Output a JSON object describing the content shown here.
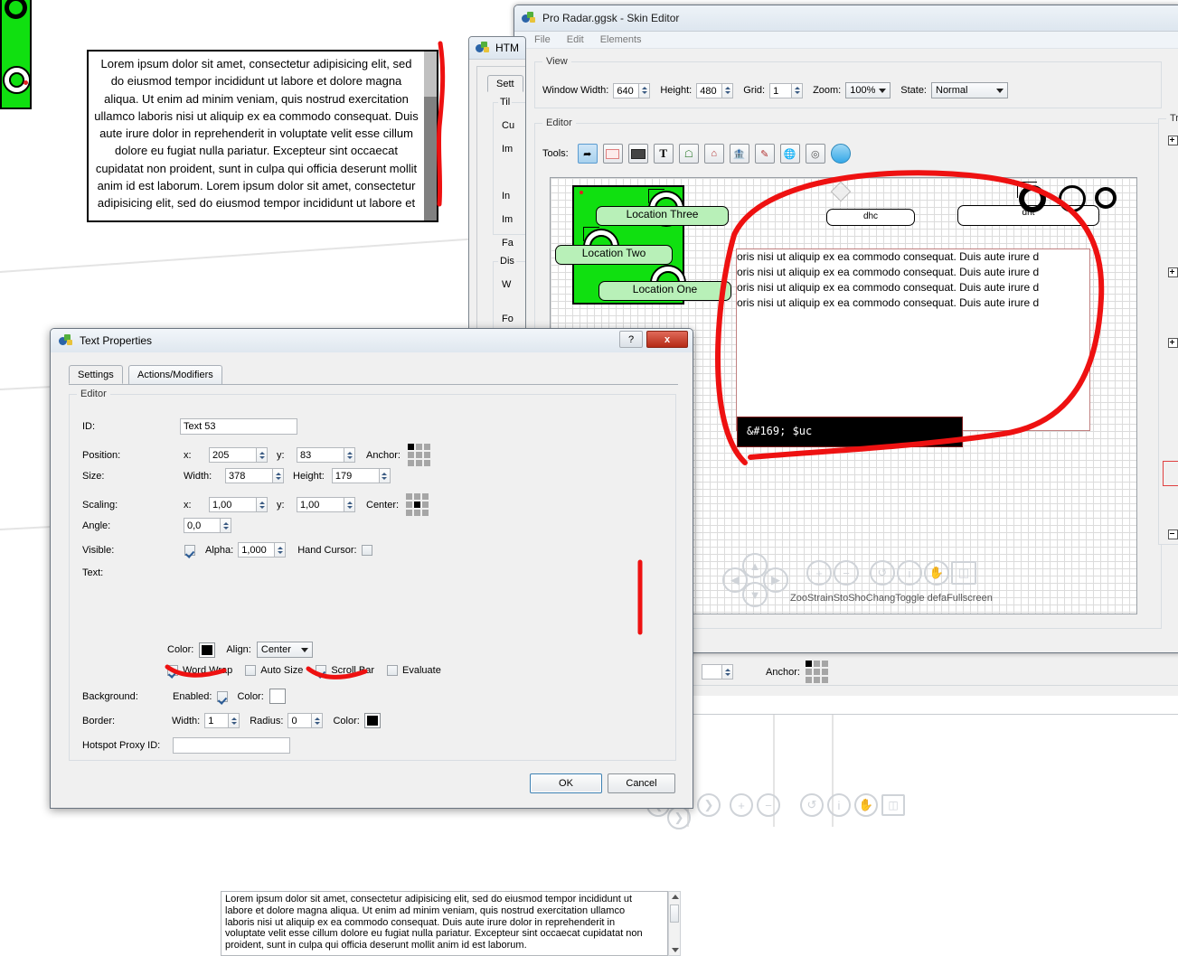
{
  "skin_editor": {
    "title": "Pro Radar.ggsk - Skin Editor",
    "menu": [
      "File",
      "Edit",
      "Elements"
    ],
    "view_group": "View",
    "view": {
      "window_width_label": "Window Width:",
      "window_width": "640",
      "height_label": "Height:",
      "height": "480",
      "grid_label": "Grid:",
      "grid": "1",
      "zoom_label": "Zoom:",
      "zoom": "100%",
      "state_label": "State:",
      "state": "Normal"
    },
    "editor_group": "Editor",
    "tools_label": "Tools:",
    "tools": [
      "select-arrow",
      "rectangle",
      "bar",
      "text",
      "image-map",
      "home",
      "building",
      "pencil",
      "globe",
      "target",
      "pin"
    ],
    "tree_group": "Tree",
    "canvas": {
      "location_labels": [
        "Location Three",
        "Location Two",
        "Location One"
      ],
      "small_boxes": [
        "dhc",
        "dnt"
      ],
      "text_element_lines": [
        "oris nisi ut aliquip ex ea commodo consequat. Duis aute irure d",
        "oris nisi ut aliquip ex ea commodo consequat. Duis aute irure d",
        "oris nisi ut aliquip ex ea commodo consequat. Duis aute irure d",
        "oris nisi ut aliquip ex ea commodo consequat. Duis aute irure d"
      ],
      "black_bar_text": "&#169; $uc",
      "nav_labels": [
        "Zoom In",
        "Zoom Out",
        "Strain/Stop Rotate",
        "Show Changelist",
        "Toggle default cycle",
        "Fullscreen"
      ],
      "nav_overlap_text": "ZooStrainStoShoChangToggle defaFullscreen"
    }
  },
  "html_dialog": {
    "title": "HTM",
    "tab": "Sett",
    "labels": [
      "Til",
      "Cu",
      "Im",
      "In",
      "Im",
      "Fa",
      "Dis",
      "W",
      "Fo"
    ]
  },
  "text_properties": {
    "title": "Text Properties",
    "help_button": "?",
    "close_button": "x",
    "tabs": [
      {
        "label": "Settings",
        "active": true
      },
      {
        "label": "Actions/Modifiers",
        "active": false
      }
    ],
    "editor_group": "Editor",
    "fields": {
      "id_label": "ID:",
      "id_value": "Text 53",
      "position_label": "Position:",
      "position_x_label": "x:",
      "position_x": "205",
      "position_y_label": "y:",
      "position_y": "83",
      "anchor_label": "Anchor:",
      "size_label": "Size:",
      "width_label": "Width:",
      "width": "378",
      "height_label": "Height:",
      "height": "179",
      "scaling_label": "Scaling:",
      "scaling_x_label": "x:",
      "scaling_x": "1,00",
      "scaling_y_label": "y:",
      "scaling_y": "1,00",
      "center_label": "Center:",
      "angle_label": "Angle:",
      "angle": "0,0",
      "visible_label": "Visible:",
      "visible_checked": true,
      "alpha_label": "Alpha:",
      "alpha": "1,000",
      "hand_cursor_label": "Hand Cursor:",
      "hand_cursor_checked": false,
      "text_label": "Text:",
      "text_value": "Lorem ipsum dolor sit amet, consectetur adipisicing elit, sed do eiusmod tempor incididunt ut labore et dolore magna aliqua. Ut enim ad minim veniam, quis nostrud exercitation ullamco laboris nisi ut aliquip ex ea commodo consequat. Duis aute irure dolor in reprehenderit in voluptate velit esse cillum dolore eu fugiat nulla pariatur. Excepteur sint occaecat cupidatat non proident, sunt in culpa qui officia deserunt mollit anim id est laborum.",
      "color_label": "Color:",
      "align_label": "Align:",
      "align_value": "Center",
      "word_wrap_label": "Word Wrap",
      "word_wrap_checked": true,
      "auto_size_label": "Auto Size",
      "auto_size_checked": false,
      "scroll_bar_label": "Scroll Bar",
      "scroll_bar_checked": true,
      "evaluate_label": "Evaluate",
      "evaluate_checked": false,
      "background_label": "Background:",
      "bg_enabled_label": "Enabled:",
      "bg_enabled_checked": true,
      "bg_color_label": "Color:",
      "border_label": "Border:",
      "border_width_label": "Width:",
      "border_width": "1",
      "border_radius_label": "Radius:",
      "border_radius": "0",
      "border_color_label": "Color:",
      "hotspot_label": "Hotspot Proxy ID:",
      "hotspot_value": ""
    },
    "ok_label": "OK",
    "cancel_label": "Cancel"
  },
  "preview_box": {
    "text": "Lorem ipsum dolor sit amet, consectetur adipisicing elit, sed do eiusmod tempor incididunt ut labore et dolore magna aliqua. Ut enim ad minim veniam, quis nostrud exercitation ullamco laboris nisi ut aliquip ex ea commodo consequat. Duis aute irure dolor in reprehenderit in voluptate velit esse cillum dolore eu fugiat nulla pariatur. Excepteur sint occaecat cupidatat non proident, sunt in culpa qui officia deserunt mollit anim id est laborum. Lorem ipsum dolor sit amet, consectetur adipisicing elit, sed do eiusmod tempor incididunt ut labore et"
  },
  "background_window": {
    "anchor_label": "Anchor:"
  },
  "colors": {
    "annotation": "#ee1111",
    "canvas_green": "#10e010",
    "accent": "#3c7fb1"
  }
}
